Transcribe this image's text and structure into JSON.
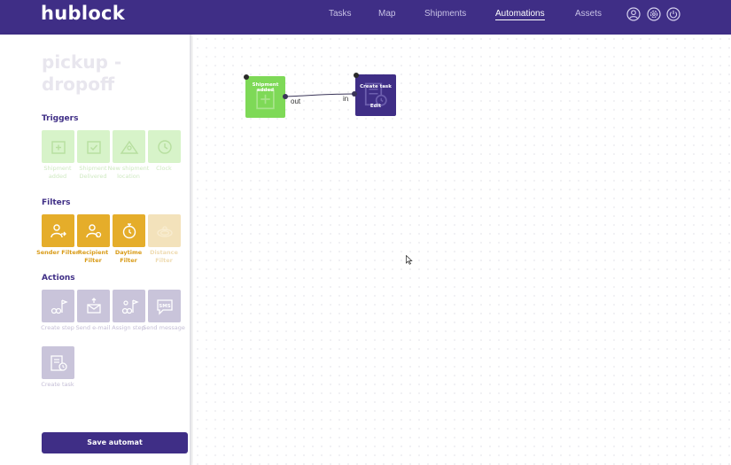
{
  "app": {
    "logo": "hublock"
  },
  "nav": {
    "items": [
      {
        "label": "Tasks"
      },
      {
        "label": "Map"
      },
      {
        "label": "Shipments"
      },
      {
        "label": "Automations"
      },
      {
        "label": "Assets"
      }
    ],
    "active": "Automations"
  },
  "sidebar": {
    "title": "pickup - dropoff",
    "triggers_heading": "Triggers",
    "triggers": [
      {
        "label": "Shipment added"
      },
      {
        "label": "Shipment Delivered"
      },
      {
        "label": "New shipment location"
      },
      {
        "label": "Clock"
      }
    ],
    "filters_heading": "Filters",
    "filters": [
      {
        "label": "Sender Filter"
      },
      {
        "label": "Recipient Filter"
      },
      {
        "label": "Daytime Filter"
      },
      {
        "label": "Distance Filter"
      }
    ],
    "actions_heading": "Actions",
    "actions": [
      {
        "label": "Create step"
      },
      {
        "label": "Send e-mail"
      },
      {
        "label": "Assign step"
      },
      {
        "label": "Send message"
      },
      {
        "label": "Create task"
      }
    ],
    "sms_icon_text": "SMS",
    "save_label": "Save automat"
  },
  "canvas": {
    "nodes": [
      {
        "title": "Shipment added",
        "port": "out"
      },
      {
        "title": "Create task",
        "subtitle": "Edit",
        "port": "in"
      }
    ]
  },
  "colors": {
    "brand": "#3f2e86",
    "trigger": "#7ed957",
    "filter": "#e5ad2a",
    "action": "#c9c4da"
  }
}
